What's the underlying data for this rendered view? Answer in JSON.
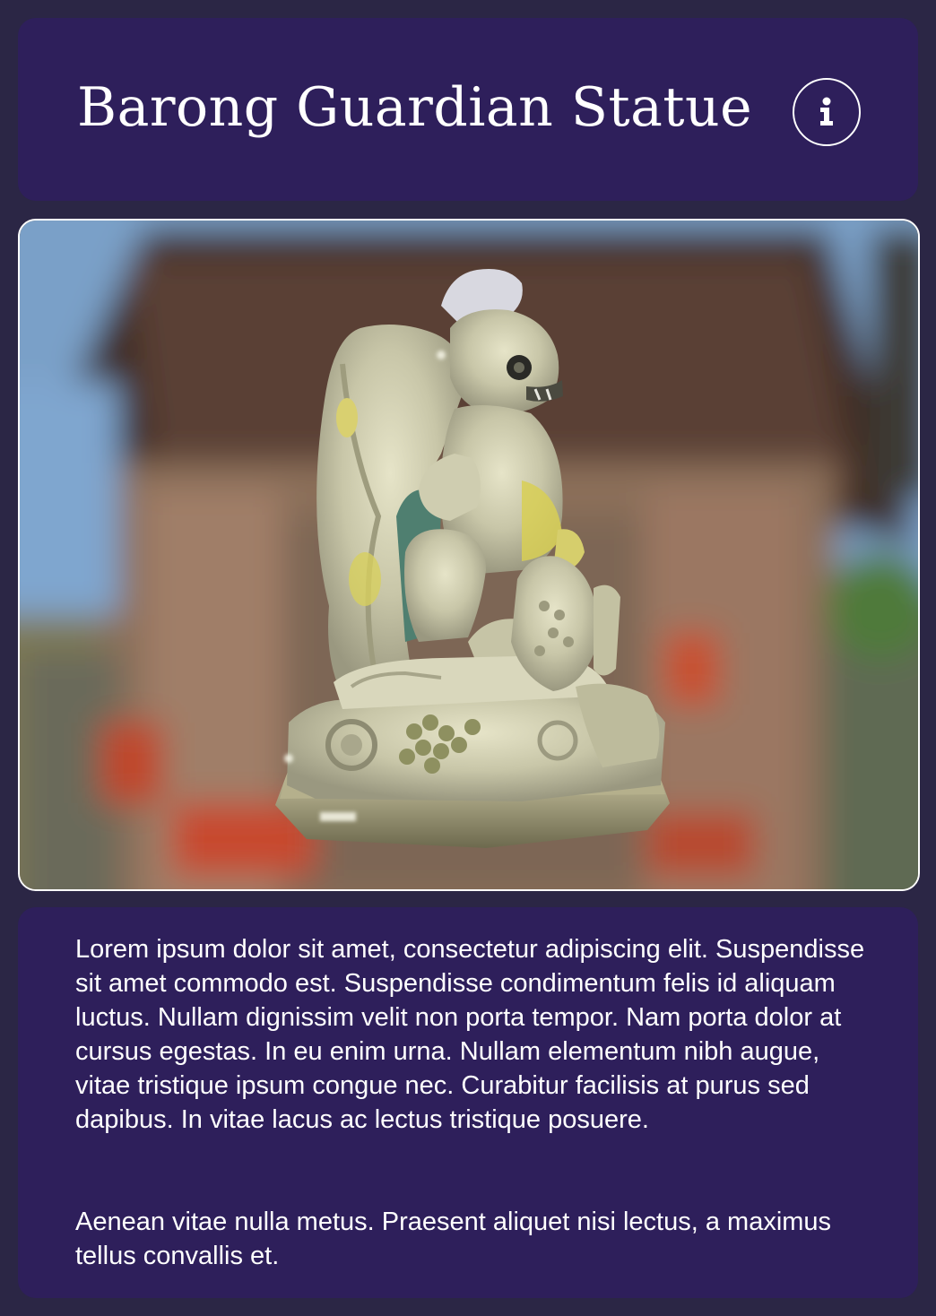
{
  "header": {
    "title": "Barong Guardian Statue",
    "info_icon": "info-icon"
  },
  "viewer": {
    "subject": "statue-3d-model"
  },
  "description": {
    "paragraphs": [
      "Lorem ipsum dolor sit amet, consectetur adipiscing elit. Suspendisse sit amet commodo est. Suspendisse condimentum felis id aliquam luctus. Nullam dignissim velit non porta tempor. Nam porta dolor at cursus egestas. In eu enim urna. Nullam elementum nibh augue, vitae tristique ipsum congue nec. Curabitur facilisis at purus sed dapibus. In vitae lacus ac lectus tristique posuere.",
      "Aenean vitae nulla metus. Praesent aliquet nisi lectus, a maximus tellus convallis et."
    ]
  },
  "colors": {
    "page_background": "#2b2645",
    "card_background": "#2e1f5b",
    "text": "#ffffff"
  }
}
